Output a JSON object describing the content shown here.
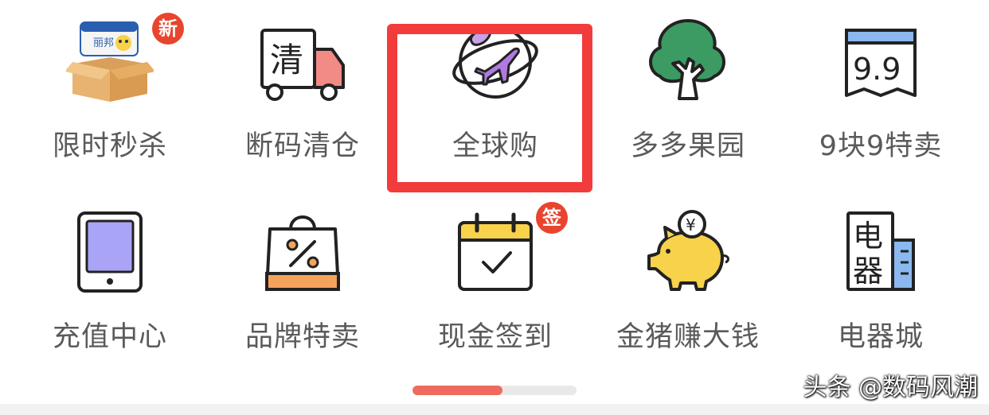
{
  "menu": {
    "items": [
      {
        "label": "限时秒杀",
        "icon": "flash-sale-box-icon",
        "badge": "新"
      },
      {
        "label": "断码清仓",
        "icon": "clearance-truck-icon",
        "badge": ""
      },
      {
        "label": "全球购",
        "icon": "global-plane-icon",
        "badge": ""
      },
      {
        "label": "多多果园",
        "icon": "tree-icon",
        "badge": ""
      },
      {
        "label": "9块9特卖",
        "icon": "calendar-99-icon",
        "badge": ""
      },
      {
        "label": "充值中心",
        "icon": "tablet-icon",
        "badge": ""
      },
      {
        "label": "品牌特卖",
        "icon": "shopping-bag-percent-icon",
        "badge": ""
      },
      {
        "label": "现金签到",
        "icon": "calendar-check-icon",
        "badge": "签"
      },
      {
        "label": "金猪赚大钱",
        "icon": "piggy-bank-icon",
        "badge": ""
      },
      {
        "label": "电器城",
        "icon": "appliance-building-icon",
        "badge": ""
      }
    ],
    "highlighted_index": 2
  },
  "icon_text": {
    "clearance": "清",
    "price_99": "9.9",
    "appliance_top": "电",
    "appliance_bottom": "器",
    "coin": "¥",
    "box_brand": "丽邦"
  },
  "pager": {
    "progress": 0.55
  },
  "watermark": "头条 @数码风潮",
  "colors": {
    "highlight": "#f23c3c",
    "badge": "#e8442e",
    "pager_active": "#ef6a5e",
    "label": "#5a5a5a"
  }
}
